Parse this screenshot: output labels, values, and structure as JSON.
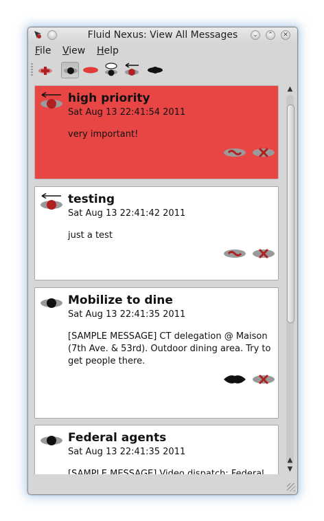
{
  "window": {
    "title": "Fluid Nexus: View All Messages"
  },
  "menu": [
    {
      "label": "File",
      "mnemonic": "F",
      "rest": "ile"
    },
    {
      "label": "View",
      "mnemonic": "V",
      "rest": "iew"
    },
    {
      "label": "Help",
      "mnemonic": "H",
      "rest": "elp"
    }
  ],
  "toolbar": {
    "tools": [
      {
        "icon": "new-message-icon"
      },
      {
        "icon": "view-all-icon",
        "pressed": true
      },
      {
        "icon": "view-outgoing-icon"
      },
      {
        "icon": "view-blacklist-icon"
      },
      {
        "icon": "view-high-priority-icon"
      },
      {
        "icon": "view-public-icon"
      }
    ]
  },
  "messages": [
    {
      "title": "high priority",
      "time": "Sat Aug 13 22:41:54 2011",
      "body": "very important!",
      "style": "high-priority",
      "icon": "outgoing-priority-icon",
      "actions": [
        "edit-message-icon",
        "delete-message-icon"
      ]
    },
    {
      "title": "testing",
      "time": "Sat Aug 13 22:41:42 2011",
      "body": "just a test",
      "style": "normal",
      "icon": "outgoing-message-icon",
      "actions": [
        "edit-message-icon",
        "delete-message-icon"
      ]
    },
    {
      "title": "Mobilize to dine",
      "time": "Sat Aug 13 22:41:35 2011",
      "body": "[SAMPLE MESSAGE] CT delegation @ Maison (7th Ave. & 53rd). Outdoor dining area. Try to get people there.",
      "style": "normal",
      "icon": "incoming-message-icon",
      "actions": [
        "blacklist-message-icon",
        "delete-message-icon"
      ]
    },
    {
      "title": "Federal agents",
      "time": "Sat Aug 13 22:41:35 2011",
      "body": "[SAMPLE MESSAGE] Video dispatch: Federal",
      "style": "normal",
      "icon": "incoming-message-icon",
      "actions": []
    }
  ],
  "colors": {
    "high_priority_bg": "#e84545",
    "card_bg": "#ffffff",
    "window_bg": "#d6d6d6",
    "accent_red": "#b02020"
  }
}
